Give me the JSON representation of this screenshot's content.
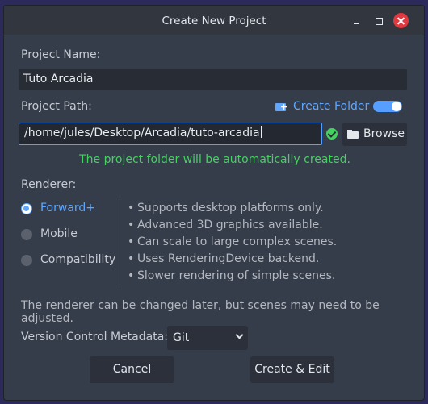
{
  "window": {
    "title": "Create New Project"
  },
  "project_name": {
    "label": "Project Name:",
    "value": "Tuto Arcadia"
  },
  "project_path": {
    "label": "Project Path:",
    "create_folder_label": "Create Folder",
    "create_folder_enabled": true,
    "value": "/home/jules/Desktop/Arcadia/tuto-arcadia",
    "browse_label": "Browse",
    "status_message": "The project folder will be automatically created."
  },
  "renderer": {
    "label": "Renderer:",
    "options": [
      "Forward+",
      "Mobile",
      "Compatibility"
    ],
    "selected": "Forward+",
    "features": [
      "Supports desktop platforms only.",
      "Advanced 3D graphics available.",
      "Can scale to large complex scenes.",
      "Uses RenderingDevice backend.",
      "Slower rendering of simple scenes."
    ],
    "note": "The renderer can be changed later, but scenes may need to be adjusted."
  },
  "vcs": {
    "label": "Version Control Metadata:",
    "selected": "Git"
  },
  "footer": {
    "cancel_label": "Cancel",
    "create_label": "Create & Edit"
  },
  "colors": {
    "accent": "#569eff",
    "success": "#45d160",
    "close": "#e0393f"
  },
  "icons": [
    "minimize-icon",
    "maximize-icon",
    "close-icon",
    "create-folder-icon",
    "valid-check-icon",
    "folder-icon",
    "chevron-down-icon"
  ]
}
